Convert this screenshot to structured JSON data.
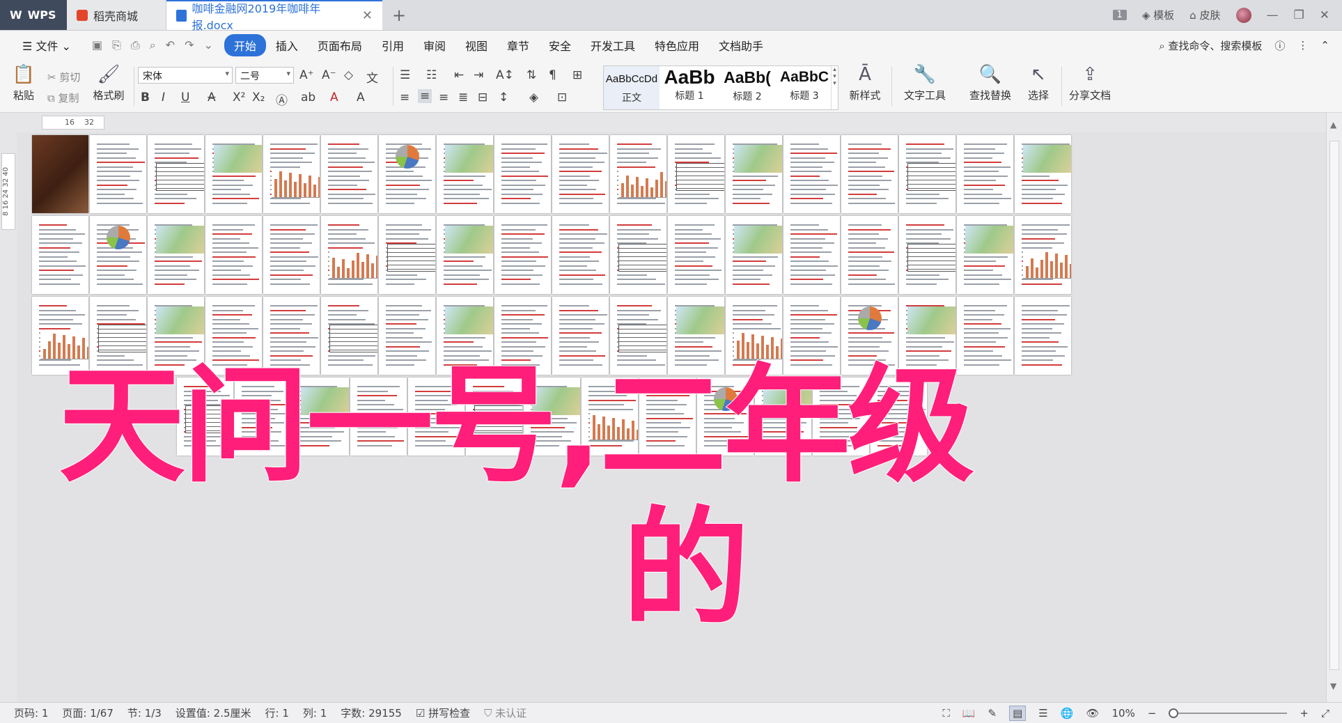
{
  "tabs": {
    "wps": "WPS",
    "shop": "稻壳商城",
    "doc": "咖啡金融网2019年咖啡年报.docx"
  },
  "titlebar_right": {
    "badge": "1",
    "template": "模板",
    "skin": "皮肤"
  },
  "menu": {
    "file": "文件",
    "items": [
      "开始",
      "插入",
      "页面布局",
      "引用",
      "审阅",
      "视图",
      "章节",
      "安全",
      "开发工具",
      "特色应用",
      "文档助手"
    ],
    "search": "查找命令、搜索模板"
  },
  "ribbon": {
    "paste": "粘贴",
    "cut": "剪切",
    "copy": "复制",
    "format_painter": "格式刷",
    "font_name": "宋体",
    "font_size": "二号",
    "styles": [
      {
        "sample": "AaBbCcDd",
        "name": "正文"
      },
      {
        "sample": "AaBb",
        "name": "标题 1"
      },
      {
        "sample": "AaBb(",
        "name": "标题 2"
      },
      {
        "sample": "AaBbC",
        "name": "标题 3"
      }
    ],
    "new_style": "新样式",
    "text_tools": "文字工具",
    "find_replace": "查找替换",
    "select": "选择",
    "share": "分享文档"
  },
  "ruler": {
    "marks": [
      "16",
      "32"
    ],
    "vmarks": "8   16   24   32   40"
  },
  "overlay": {
    "line1": "天问一号,二年级",
    "line2": "的"
  },
  "status": {
    "page_num": "页码: 1",
    "page": "页面: 1/67",
    "section": "节: 1/3",
    "setting": "设置值: 2.5厘米",
    "row": "行: 1",
    "col": "列: 1",
    "word_count": "字数: 29155",
    "spell": "拼写检查",
    "cert": "未认证",
    "zoom": "10%"
  },
  "colors": {
    "accent": "#2d72d9",
    "overlay_text": "#ff1f7a"
  }
}
